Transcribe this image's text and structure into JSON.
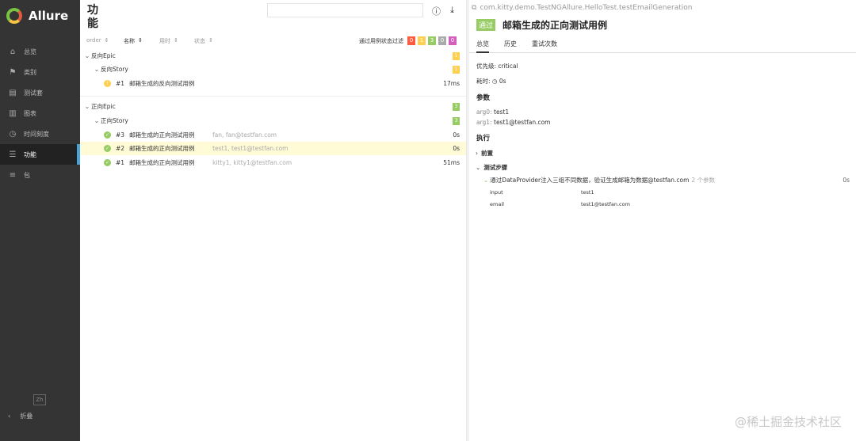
{
  "app": {
    "brand": "Allure",
    "lang": "Zh",
    "collapse_label": "折叠"
  },
  "nav": [
    {
      "label": "总览",
      "icon": "home-icon",
      "glyph": "⌂"
    },
    {
      "label": "类别",
      "icon": "flag-icon",
      "glyph": "⚑"
    },
    {
      "label": "测试套",
      "icon": "briefcase-icon",
      "glyph": "▤"
    },
    {
      "label": "图表",
      "icon": "chart-icon",
      "glyph": "▥"
    },
    {
      "label": "时间刻度",
      "icon": "clock-icon",
      "glyph": "◷"
    },
    {
      "label": "功能",
      "icon": "list-icon",
      "glyph": "☰",
      "active": true
    },
    {
      "label": "包",
      "icon": "package-icon",
      "glyph": "≡"
    }
  ],
  "left": {
    "title": "功能",
    "columns": [
      "order",
      "名称",
      "用时",
      "状态"
    ],
    "filter_label": "通过用例状态过滤",
    "filter_counts": [
      "0",
      "1",
      "3",
      "0",
      "0"
    ],
    "filter_colors": [
      "#fd5a3e",
      "#ffd050",
      "#97cc64",
      "#aaaaaa",
      "#d35ebe"
    ],
    "epics": [
      {
        "name": "反向Epic",
        "badge": "1",
        "badge_color": "#ffd050",
        "story": {
          "name": "反向Story",
          "badge": "1"
        },
        "tests": [
          {
            "num": "#1",
            "name": "邮箱生成的反向测试用例",
            "params": "",
            "duration": "17ms",
            "status": "broken"
          }
        ]
      },
      {
        "name": "正向Epic",
        "badge": "3",
        "badge_color": "#97cc64",
        "story": {
          "name": "正向Story",
          "badge": "3"
        },
        "tests": [
          {
            "num": "#3",
            "name": "邮箱生成的正向测试用例",
            "params": "fan, fan@testfan.com",
            "duration": "0s",
            "status": "passed"
          },
          {
            "num": "#2",
            "name": "邮箱生成的正向测试用例",
            "params": "test1, test1@testfan.com",
            "duration": "0s",
            "status": "passed",
            "selected": true
          },
          {
            "num": "#1",
            "name": "邮箱生成的正向测试用例",
            "params": "kitty1, kitty1@testfan.com",
            "duration": "51ms",
            "status": "passed"
          }
        ]
      }
    ]
  },
  "right": {
    "full_name": "com.kitty.demo.TestNGAllure.HelloTest.testEmailGeneration",
    "status_label": "通过",
    "test_name": "邮箱生成的正向测试用例",
    "tabs": [
      "总览",
      "历史",
      "重试次数"
    ],
    "severity_label": "优先级:",
    "severity": "critical",
    "duration_label": "耗时:",
    "duration": "0s",
    "params_title": "参数",
    "params": [
      {
        "key": "arg0:",
        "value": "test1"
      },
      {
        "key": "arg1:",
        "value": "test1@testfan.com"
      }
    ],
    "exec_title": "执行",
    "setup_label": "前置",
    "body_label": "测试步骤",
    "step": {
      "text": "通过DataProvider注入三组不同数据，验证生成邮箱为数据@testfan.com",
      "param_count": "2 个参数",
      "duration": "0s",
      "params": [
        {
          "name": "input",
          "value": "test1"
        },
        {
          "name": "email",
          "value": "test1@testfan.com"
        }
      ]
    }
  },
  "watermark": "@稀土掘金技术社区"
}
